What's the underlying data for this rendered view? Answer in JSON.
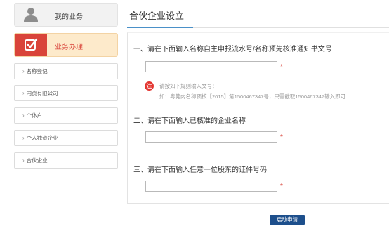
{
  "sidebar": {
    "profile": {
      "label": "我的业务",
      "icon": "user-icon"
    },
    "business": {
      "label": "业务办理",
      "icon": "checkbox-icon",
      "accent": "#d9443a"
    },
    "items": [
      {
        "label": "名称登记"
      },
      {
        "label": "内资有限公司"
      },
      {
        "label": "个体户"
      },
      {
        "label": "个人独资企业"
      },
      {
        "label": "合伙企业"
      }
    ]
  },
  "main": {
    "title": "合伙企业设立",
    "q1": {
      "label": "一、请在下面输入名称自主申报流水号/名称预先核准通知书文号",
      "value": "",
      "required_mark": "*"
    },
    "note": {
      "badge": "注",
      "line1": "请按如下规则输入文号：",
      "line2": "如：粤莞内名称预核【2015】第1500467347号，只需截取1500467347输入即可"
    },
    "q2": {
      "label": "二、请在下面输入已核准的企业名称",
      "value": "",
      "required_mark": "*"
    },
    "q3": {
      "label": "三、请在下面输入任意一位股东的证件号码",
      "value": "",
      "required_mark": "*"
    },
    "submit_label": "启动申请"
  },
  "colors": {
    "accent_blue": "#4a90c8",
    "button_navy": "#1d4f8c",
    "active_bg": "#fdeacb"
  }
}
